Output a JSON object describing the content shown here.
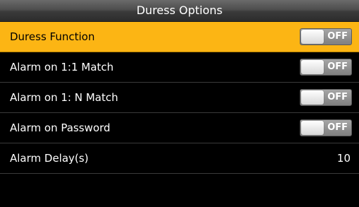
{
  "header": {
    "title": "Duress Options"
  },
  "items": [
    {
      "label": "Duress Function",
      "toggle": "OFF"
    },
    {
      "label": "Alarm on 1:1 Match",
      "toggle": "OFF"
    },
    {
      "label": "Alarm on 1: N Match",
      "toggle": "OFF"
    },
    {
      "label": "Alarm on Password",
      "toggle": "OFF"
    },
    {
      "label": "Alarm Delay(s)",
      "value": "10"
    }
  ],
  "colors": {
    "selected_row": "#fcb514",
    "background": "#000000"
  }
}
